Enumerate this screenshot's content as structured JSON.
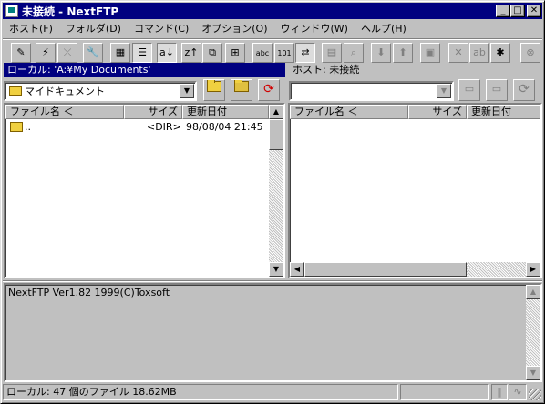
{
  "window": {
    "title": "未接続 - NextFTP",
    "min_glyph": "_",
    "max_glyph": "□",
    "close_glyph": "✕"
  },
  "menu": [
    "ホスト(F)",
    "フォルダ(D)",
    "コマンド(C)",
    "オプション(O)",
    "ウィンドウ(W)",
    "ヘルプ(H)"
  ],
  "toolbar": {
    "buttons": [
      {
        "name": "connect-icon",
        "glyph": "✎",
        "pressed": false,
        "disabled": false
      },
      {
        "name": "quick-connect-icon",
        "glyph": "⚡",
        "pressed": false,
        "disabled": false
      },
      {
        "name": "disconnect-icon",
        "glyph": "⤫",
        "pressed": false,
        "disabled": true
      },
      {
        "name": "settings-wrench-icon",
        "glyph": "🔧",
        "pressed": false,
        "disabled": false
      },
      {
        "name": "large-icons-view-icon",
        "glyph": "▦",
        "pressed": false,
        "disabled": false
      },
      {
        "name": "details-view-icon",
        "glyph": "☰",
        "pressed": true,
        "disabled": false
      },
      {
        "name": "sort-ascending-icon",
        "glyph": "a↓",
        "pressed": true,
        "disabled": false
      },
      {
        "name": "sort-descending-icon",
        "glyph": "z↑",
        "pressed": false,
        "disabled": false
      },
      {
        "name": "copy-windows-icon",
        "glyph": "⧉",
        "pressed": false,
        "disabled": false
      },
      {
        "name": "tile-windows-icon",
        "glyph": "⊞",
        "pressed": false,
        "disabled": false
      },
      {
        "name": "text-mode-icon",
        "glyph": "abc",
        "pressed": false,
        "disabled": false
      },
      {
        "name": "binary-mode-icon",
        "glyph": "101",
        "pressed": false,
        "disabled": false
      },
      {
        "name": "auto-mode-icon",
        "glyph": "⇄",
        "pressed": true,
        "disabled": false
      },
      {
        "name": "server-icon",
        "glyph": "▤",
        "pressed": false,
        "disabled": true
      },
      {
        "name": "find-icon",
        "glyph": "⌕",
        "pressed": false,
        "disabled": true
      },
      {
        "name": "download-icon",
        "glyph": "⬇",
        "pressed": false,
        "disabled": true
      },
      {
        "name": "upload-icon",
        "glyph": "⬆",
        "pressed": false,
        "disabled": true
      },
      {
        "name": "properties-icon",
        "glyph": "▣",
        "pressed": false,
        "disabled": true
      },
      {
        "name": "delete-icon",
        "glyph": "✕",
        "pressed": false,
        "disabled": true
      },
      {
        "name": "rename-icon",
        "glyph": "ab",
        "pressed": false,
        "disabled": true
      },
      {
        "name": "new-folder-icon",
        "glyph": "✱",
        "pressed": false,
        "disabled": false
      },
      {
        "name": "stop-icon",
        "glyph": "⊗",
        "pressed": false,
        "disabled": true
      }
    ]
  },
  "local": {
    "label": "ローカル: 'A:¥My Documents'",
    "combo_value": "マイドキュメント",
    "col_name": "ファイル名 ＜",
    "col_size": "サイズ",
    "col_date": "更新日付",
    "rows": [
      {
        "name": "..",
        "size": "<DIR>",
        "date": "98/08/04 21:45"
      }
    ]
  },
  "remote": {
    "label": "ホスト: 未接続",
    "combo_value": "",
    "col_name": "ファイル名 ＜",
    "col_size": "サイズ",
    "col_date": "更新日付"
  },
  "log": {
    "lines": [
      "NextFTP Ver1.82 1999(C)Toxsoft"
    ]
  },
  "status": {
    "text": "ローカル: 47 個のファイル  18.62MB"
  },
  "colors": {
    "titlebar": "#000080",
    "local_label_bg": "#000080",
    "selection": "#000080",
    "face": "#c0c0c0"
  }
}
